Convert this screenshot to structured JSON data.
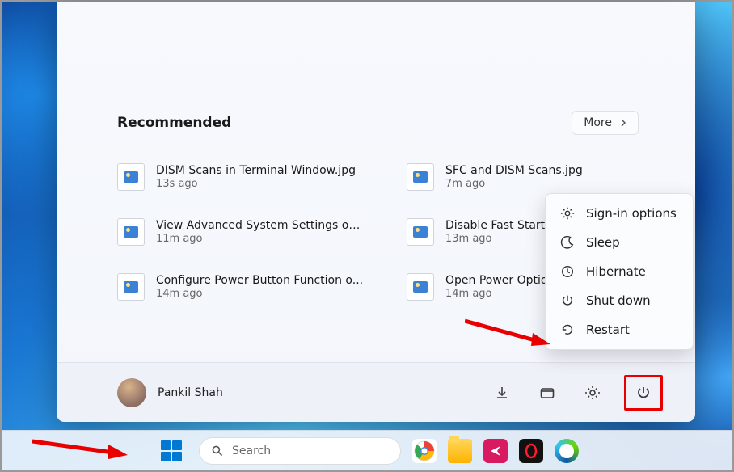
{
  "start": {
    "recommended_title": "Recommended",
    "more_label": "More",
    "items": [
      {
        "name": "DISM Scans in Terminal Window.jpg",
        "time": "13s ago"
      },
      {
        "name": "SFC and DISM Scans.jpg",
        "time": "7m ago"
      },
      {
        "name": "View Advanced System Settings on...",
        "time": "11m ago"
      },
      {
        "name": "Disable Fast Startu...",
        "time": "13m ago"
      },
      {
        "name": "Configure Power Button Function o...",
        "time": "14m ago"
      },
      {
        "name": "Open Power Optio...",
        "time": "14m ago"
      }
    ],
    "user_name": "Pankil Shah"
  },
  "power_menu": {
    "signin": "Sign-in options",
    "sleep": "Sleep",
    "hibernate": "Hibernate",
    "shutdown": "Shut down",
    "restart": "Restart"
  },
  "taskbar": {
    "search_placeholder": "Search"
  }
}
